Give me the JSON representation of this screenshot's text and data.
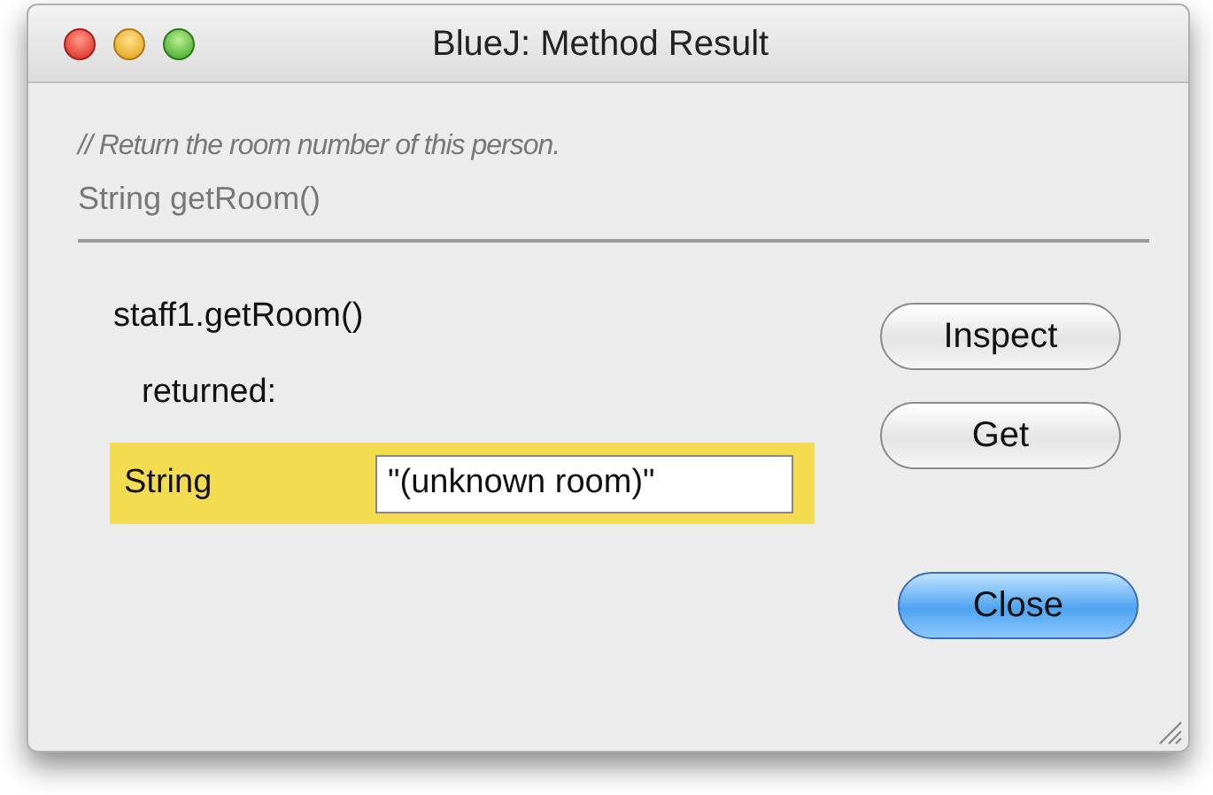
{
  "window": {
    "title": "BlueJ:  Method Result",
    "controls": [
      {
        "kind": "close"
      },
      {
        "kind": "minimize"
      },
      {
        "kind": "zoom"
      }
    ]
  },
  "comment": "// Return the room number of this person.",
  "signature": "String getRoom()",
  "call": "staff1.getRoom()",
  "returned_label": "returned:",
  "result": {
    "type": "String",
    "value": "\"(unknown room)\""
  },
  "buttons": [
    {
      "label": "Inspect",
      "default": false
    },
    {
      "label": "Get",
      "default": false
    },
    {
      "label": "Close",
      "default": true
    }
  ]
}
